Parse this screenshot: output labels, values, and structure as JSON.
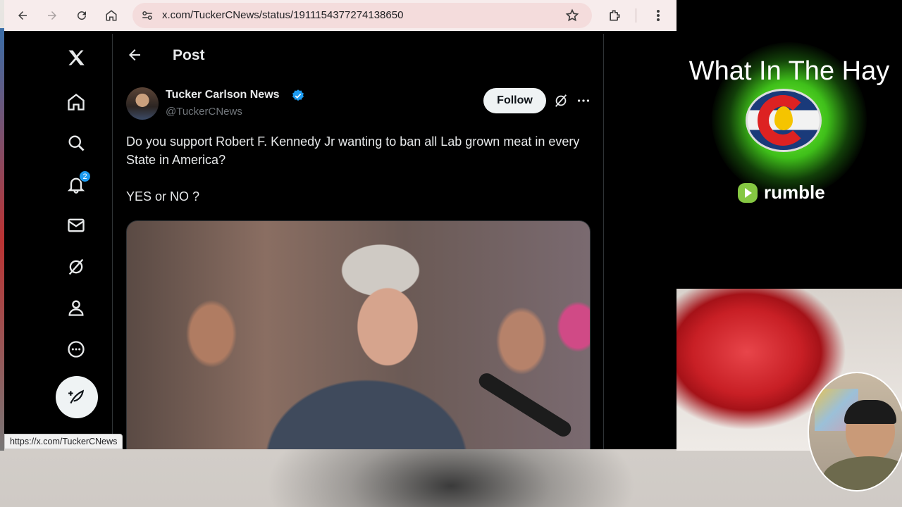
{
  "browser": {
    "url": "x.com/TuckerCNews/status/1911154377274138650",
    "status_url": "https://x.com/TuckerCNews"
  },
  "nav": {
    "notification_count": "2",
    "items": [
      "x-logo",
      "home-icon",
      "search-icon",
      "bell-icon",
      "mail-icon",
      "grok-icon",
      "profile-icon",
      "more-icon"
    ]
  },
  "post": {
    "header_title": "Post",
    "author_name": "Tucker Carlson News",
    "handle": "@TuckerCNews",
    "follow_label": "Follow",
    "text_line1": "Do you support Robert F. Kennedy Jr wanting to ban all Lab grown meat in every State in America?",
    "text_line2": "YES or NO ?"
  },
  "overlay": {
    "title": "What In The Hay",
    "rumble_label": "rumble"
  },
  "colors": {
    "verified": "#1d9bf0",
    "follow_bg": "#eff3f4",
    "rumble_green": "#85c742"
  }
}
